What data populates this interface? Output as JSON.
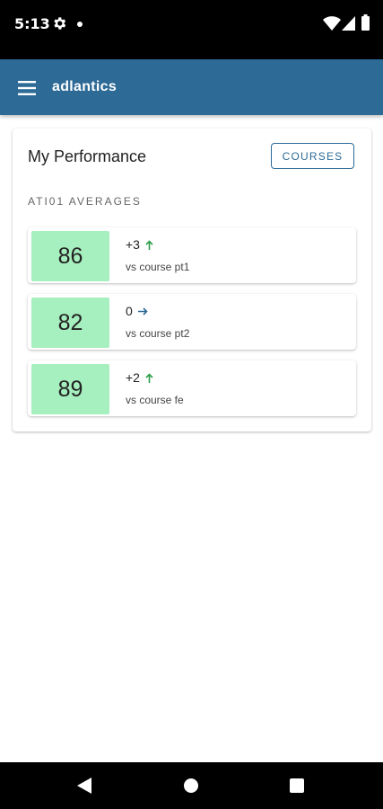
{
  "status_bar": {
    "time": "5:13",
    "icons": [
      "gear-icon",
      "notification-dot-icon",
      "wifi-icon",
      "signal-icon",
      "battery-icon"
    ]
  },
  "app_bar": {
    "title": "adlantics",
    "menu_icon": "menu-icon",
    "color": "#2d6a96"
  },
  "card": {
    "title": "My Performance",
    "courses_button": "COURSES",
    "section_label": "ATI01 AVERAGES",
    "metrics": [
      {
        "score": "86",
        "delta": "+3",
        "trend": "up",
        "compare": "vs course pt1"
      },
      {
        "score": "82",
        "delta": "0",
        "trend": "flat",
        "compare": "vs course pt2"
      },
      {
        "score": "89",
        "delta": "+2",
        "trend": "up",
        "compare": "vs course fe"
      }
    ]
  },
  "colors": {
    "score_background": "#a6efbe",
    "trend_up": "#2e9e4b",
    "trend_flat": "#2d6a96"
  },
  "nav_bar": {
    "icons": [
      "back-icon",
      "home-icon",
      "recents-icon"
    ]
  }
}
